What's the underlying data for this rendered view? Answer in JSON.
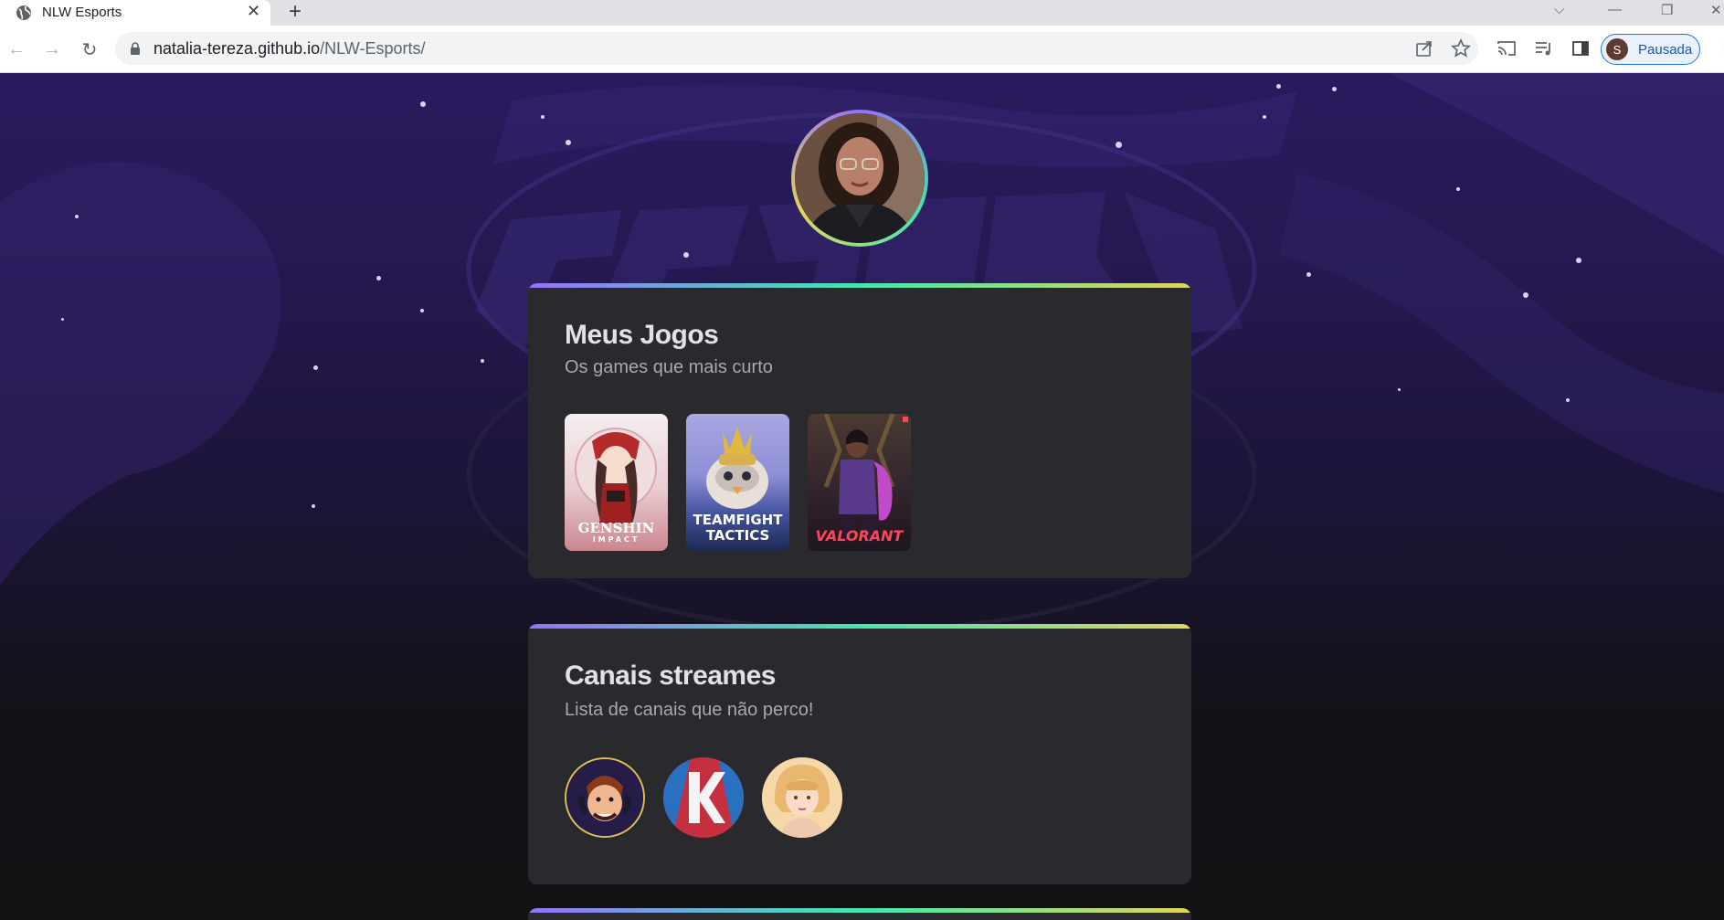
{
  "browser": {
    "tab_title": "NLW Esports",
    "url_host": "natalia-tereza.github.io",
    "url_path": "/NLW-Esports/",
    "profile_initial": "S",
    "profile_label": "Pausada"
  },
  "games_card": {
    "title": "Meus Jogos",
    "subtitle": "Os games que mais curto",
    "games": [
      {
        "name": "GENSHIN",
        "sub": "IMPACT"
      },
      {
        "name": "TEAMFIGHT",
        "sub": "TACTICS"
      },
      {
        "name": "VALORANT"
      }
    ]
  },
  "channels_card": {
    "title": "Canais streames",
    "subtitle": "Lista de canais que não perco!"
  },
  "colors": {
    "accent_purple": "#9572fc",
    "accent_green": "#43e7ad",
    "accent_yellow": "#e1d55d",
    "card_bg": "#29292e"
  }
}
